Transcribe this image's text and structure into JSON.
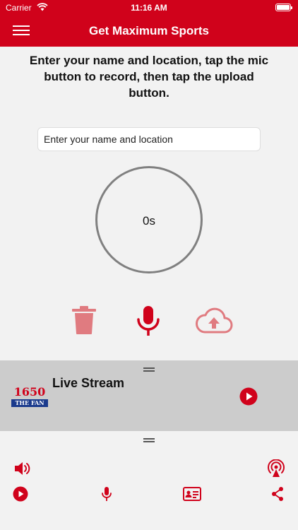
{
  "status_bar": {
    "carrier": "Carrier",
    "time": "11:16 AM"
  },
  "nav": {
    "title": "Get Maximum Sports",
    "menu_icon": "hamburger-menu-icon"
  },
  "record": {
    "instructions": "Enter your name and location, tap the mic button to record, then tap the upload button.",
    "name_placeholder": "Enter your name and location",
    "timer": "0s"
  },
  "live": {
    "title": "Live Stream",
    "logo_number": "1650",
    "logo_tagline": "THE FAN"
  },
  "colors": {
    "brand": "#d0021b",
    "muted_brand": "#e07b80",
    "panel": "#cccccc"
  }
}
